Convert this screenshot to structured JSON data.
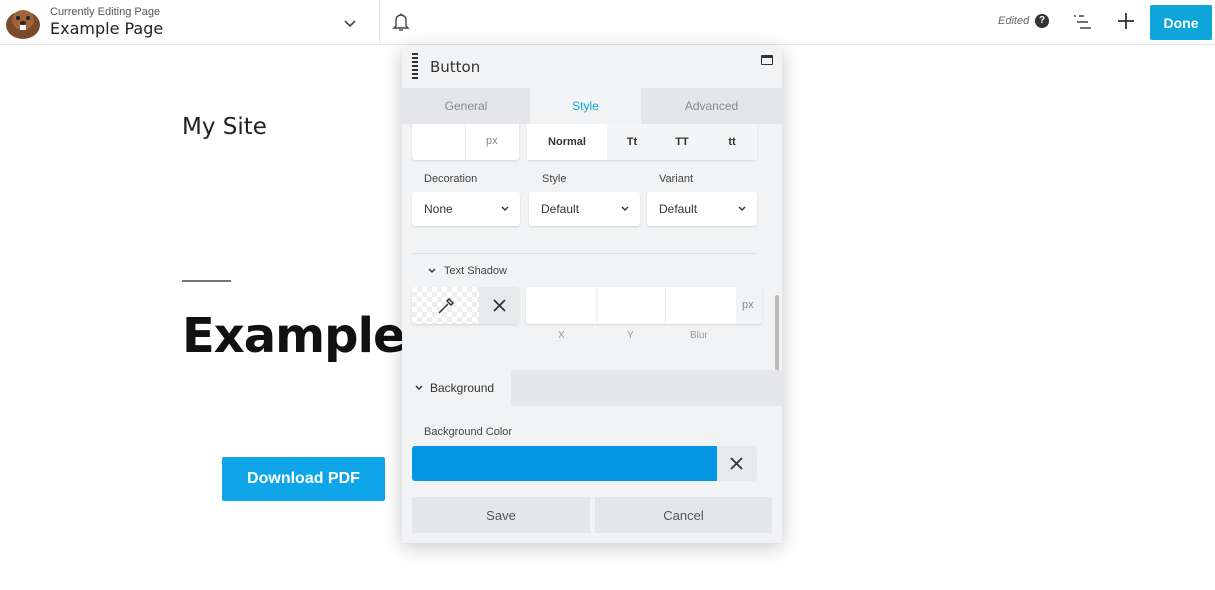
{
  "topbar": {
    "subtitle": "Currently Editing Page",
    "page_title": "Example Page",
    "status": "Edited",
    "done_label": "Done"
  },
  "page": {
    "site_name": "My Site",
    "heading": "Example Page",
    "download_button": "Download PDF"
  },
  "panel": {
    "title": "Button",
    "tabs": [
      "General",
      "Style",
      "Advanced"
    ],
    "active_tab": "Style",
    "font_size": {
      "value": "",
      "unit": "px"
    },
    "transform_options": [
      "Normal",
      "Tt",
      "TT",
      "tt"
    ],
    "decoration": {
      "label": "Decoration",
      "value": "None"
    },
    "style": {
      "label": "Style",
      "value": "Default"
    },
    "variant": {
      "label": "Variant",
      "value": "Default"
    },
    "text_shadow": {
      "label": "Text Shadow",
      "unit": "px",
      "axes": [
        "X",
        "Y",
        "Blur"
      ]
    },
    "background": {
      "section_label": "Background",
      "color_label": "Background Color",
      "color": "#0396e2"
    },
    "save_label": "Save",
    "cancel_label": "Cancel"
  }
}
